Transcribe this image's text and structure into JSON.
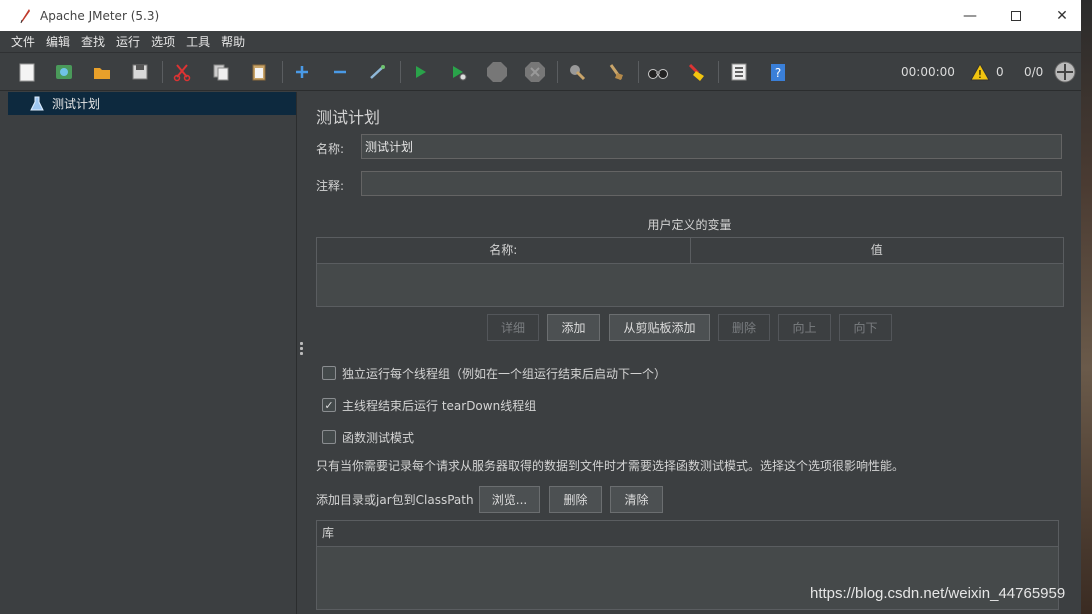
{
  "window": {
    "title": "Apache JMeter (5.3)"
  },
  "menu": [
    "文件",
    "编辑",
    "查找",
    "运行",
    "选项",
    "工具",
    "帮助"
  ],
  "toolbar": {
    "timer": "00:00:00",
    "warnings": "0",
    "threads": "0/0"
  },
  "tree": {
    "items": [
      {
        "label": "测试计划"
      }
    ]
  },
  "panel": {
    "heading": "测试计划",
    "name_label": "名称:",
    "name_value": "测试计划",
    "comment_label": "注释:",
    "comment_value": "",
    "vars_title": "用户定义的变量",
    "columns": [
      "名称:",
      "值"
    ],
    "buttons": {
      "detail": "详细",
      "add": "添加",
      "paste": "从剪贴板添加",
      "delete": "删除",
      "up": "向上",
      "down": "向下"
    },
    "options": [
      {
        "label": "独立运行每个线程组（例如在一个组运行结束后启动下一个）",
        "checked": false
      },
      {
        "label": "主线程结束后运行 tearDown线程组",
        "checked": true
      },
      {
        "label": "函数测试模式",
        "checked": false
      }
    ],
    "note": "只有当你需要记录每个请求从服务器取得的数据到文件时才需要选择函数测试模式。选择这个选项很影响性能。",
    "classpath_label": "添加目录或jar包到ClassPath",
    "classpath_buttons": {
      "browse": "浏览...",
      "delete": "删除",
      "clear": "清除"
    },
    "lib_header": "库"
  },
  "watermark": "https://blog.csdn.net/weixin_44765959"
}
